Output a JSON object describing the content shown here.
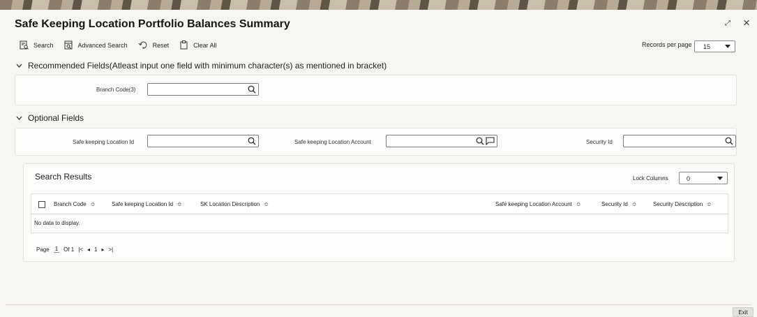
{
  "window": {
    "title": "Safe Keeping Location Portfolio Balances Summary",
    "expand_glyph": "⤢",
    "close_glyph": "×"
  },
  "toolbar": {
    "search_label": "Search",
    "advanced_search_label": "Advanced Search",
    "reset_label": "Reset",
    "clear_all_label": "Clear All",
    "records_per_page_label": "Records per page",
    "records_per_page_value": "15"
  },
  "recommended": {
    "heading": "Recommended Fields(Atleast input one field with minimum character(s) as mentioned in bracket)",
    "branch_code_label": "Branch Code(3)",
    "branch_code_value": ""
  },
  "optional": {
    "heading": "Optional Fields",
    "sk_location_id_label": "Safe keeping Location Id",
    "sk_location_id_value": "",
    "sk_location_account_label": "Safe keeping Location Account",
    "sk_location_account_value": "",
    "security_id_label": "Security Id",
    "security_id_value": ""
  },
  "results": {
    "title": "Search Results",
    "lock_columns_label": "Lock Columns",
    "lock_columns_value": "0",
    "columns": [
      "Branch Code",
      "Safe keeping Location Id",
      "SK Location Description",
      "Safe keeping Location Account",
      "Security Id",
      "Security Description"
    ],
    "sort_glyph": "≎",
    "no_data": "No data to display."
  },
  "pager": {
    "page_label": "Page",
    "page_value": "1",
    "of_label": "Of 1",
    "first_glyph": "|<",
    "prev_glyph": "◂",
    "current": "1",
    "next_glyph": "▸",
    "last_glyph": ">|"
  },
  "footer": {
    "exit_label": "Exit"
  }
}
